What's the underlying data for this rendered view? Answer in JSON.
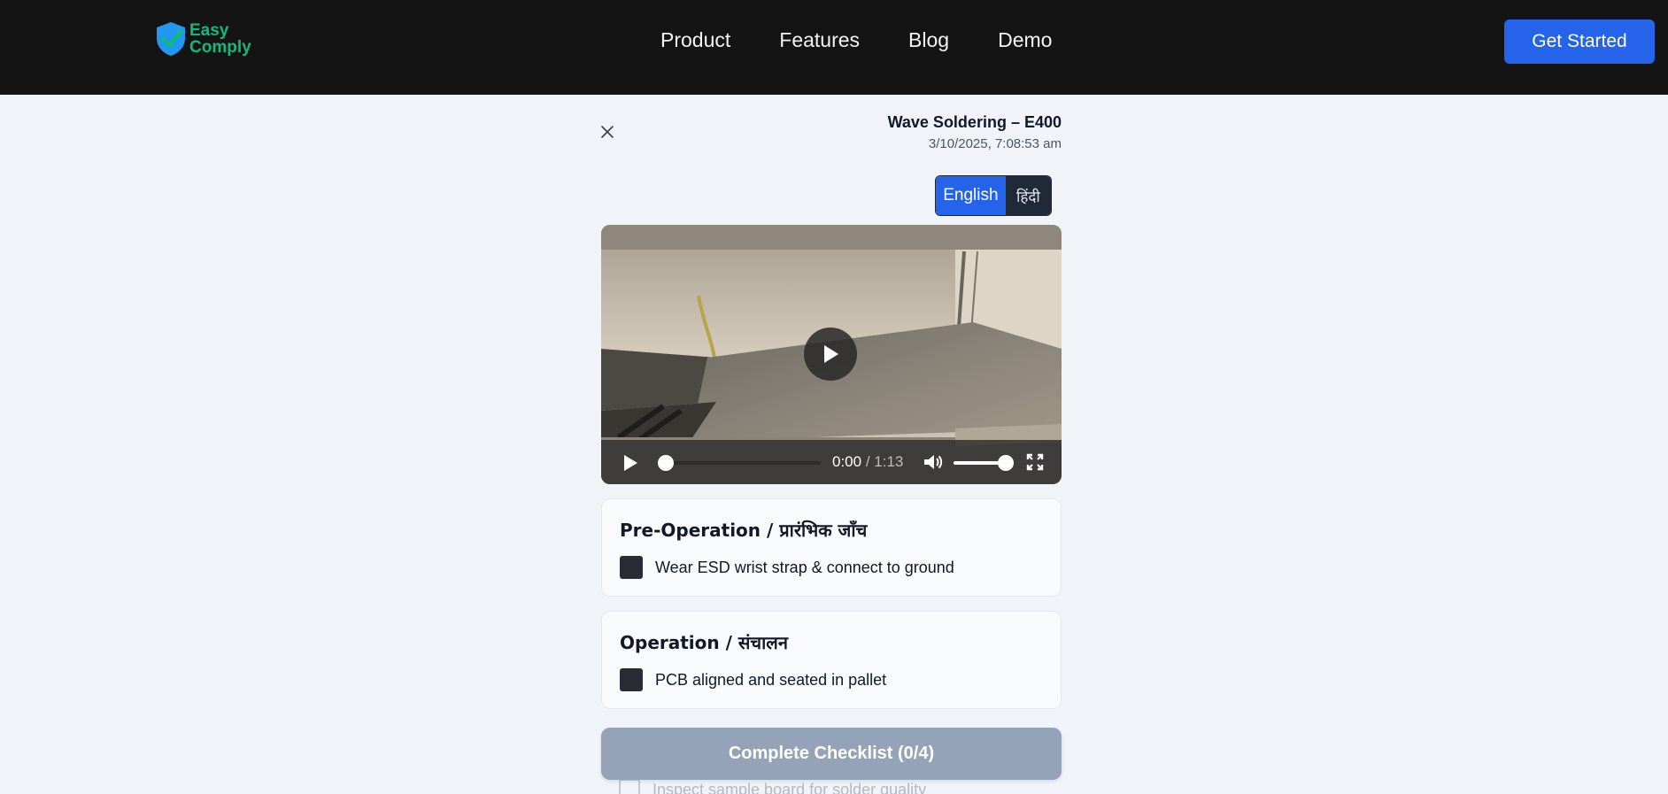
{
  "brand": {
    "line1": "Easy",
    "line2": "Comply"
  },
  "nav": {
    "items": [
      "Product",
      "Features",
      "Blog",
      "Demo"
    ],
    "cta": "Get Started"
  },
  "record": {
    "title": "Wave Soldering – E400",
    "timestamp": "3/10/2025, 7:08:53 am"
  },
  "language": {
    "options": [
      "English",
      "हिंदी"
    ],
    "selected": "English"
  },
  "video": {
    "current": "0:00",
    "separator": " / ",
    "duration": "1:13",
    "progress": 0,
    "volume": 1.0
  },
  "sections": [
    {
      "title": "Pre-Operation / प्रारंभिक जाँच",
      "items": [
        {
          "label": "Wear ESD wrist strap & connect to ground",
          "checked": false
        }
      ]
    },
    {
      "title": "Operation / संचालन",
      "items": [
        {
          "label": "PCB aligned and seated in pallet",
          "checked": false
        }
      ]
    }
  ],
  "partially_visible_item": "Inspect sample board for solder quality",
  "complete_button": "Complete Checklist (0/4)",
  "colors": {
    "accent": "#2563eb",
    "brand_green": "#10b981",
    "nav_bg": "#141414",
    "disabled_button": "#94a3b8"
  }
}
